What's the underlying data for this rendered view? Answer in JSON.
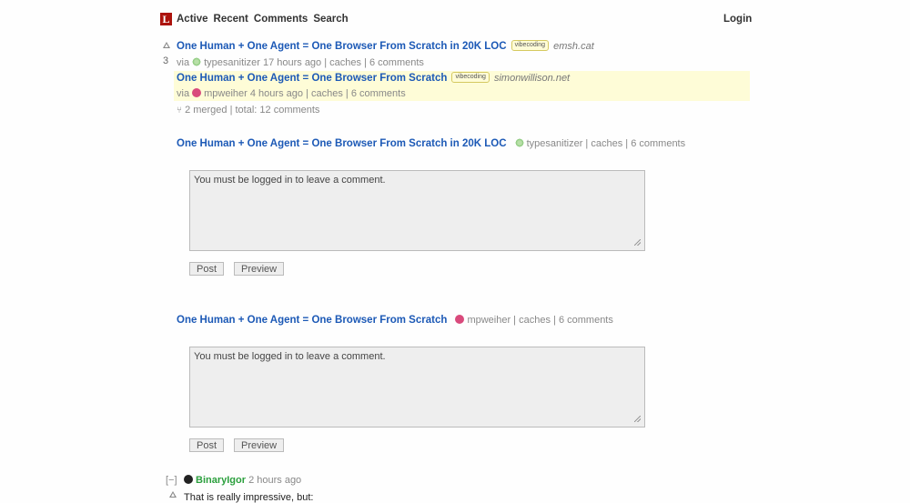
{
  "header": {
    "logo": "L",
    "nav": [
      "Active",
      "Recent",
      "Comments",
      "Search"
    ],
    "login": "Login"
  },
  "story": {
    "score": "3",
    "title": "One Human + One Agent = One Browser From Scratch in 20K LOC",
    "tag": "vibecoding",
    "domain": "emsh.cat",
    "via": "via",
    "user": "typesanitizer",
    "age": "17 hours ago",
    "caches": "caches",
    "comments": "6 comments"
  },
  "merged": {
    "title": "One Human + One Agent = One Browser From Scratch",
    "tag": "vibecoding",
    "domain": "simonwillison.net",
    "via": "via",
    "user": "mpweiher",
    "age": "4 hours ago",
    "caches": "caches",
    "comments": "6 comments"
  },
  "merged_summary": {
    "icon": "merge-icon",
    "text": "2 merged | total: 12 comments"
  },
  "comment_sections": [
    {
      "title": "One Human + One Agent = One Browser From Scratch in 20K LOC",
      "user": "typesanitizer",
      "caches": "caches",
      "comments": "6 comments",
      "placeholder": "You must be logged in to leave a comment.",
      "post": "Post",
      "preview": "Preview"
    },
    {
      "title": "One Human + One Agent = One Browser From Scratch",
      "user": "mpweiher",
      "caches": "caches",
      "comments": "6 comments",
      "placeholder": "You must be logged in to leave a comment.",
      "post": "Post",
      "preview": "Preview"
    }
  ],
  "comment": {
    "collapse": "[−]",
    "user": "BinaryIgor",
    "age": "2 hours ago",
    "text": "That is really impressive, but:"
  },
  "colors": {
    "link": "#1c59b6",
    "merged_bg": "#fefcd7",
    "comment_user": "#2b9f3d",
    "logo": "#ac130d"
  }
}
